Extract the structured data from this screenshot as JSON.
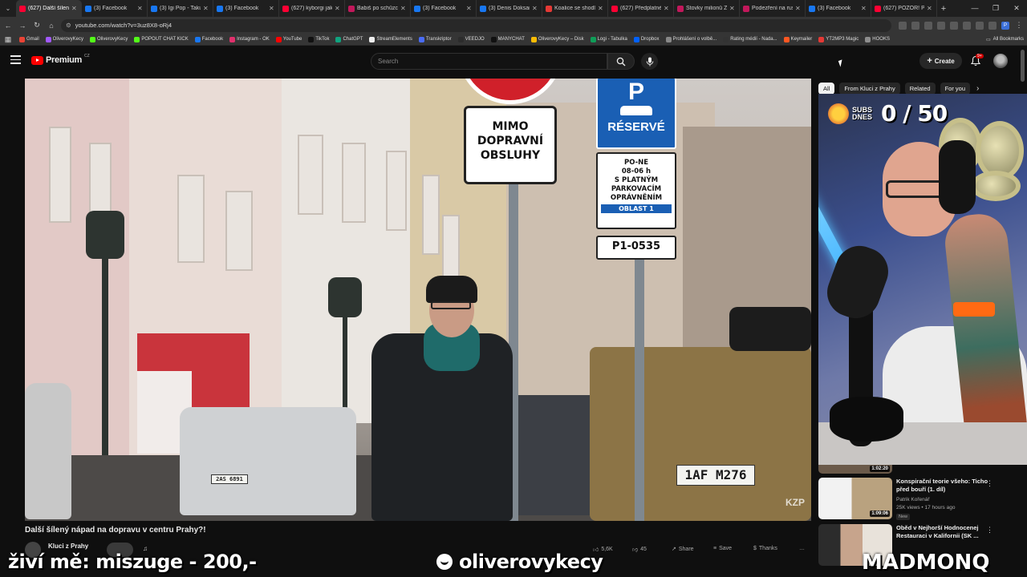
{
  "browser": {
    "tabs": [
      {
        "title": "(627) Další šílený",
        "color": "#ff0033",
        "active": true
      },
      {
        "title": "(3) Facebook",
        "color": "#1877f2"
      },
      {
        "title": "(3) Igi Pop - Taku",
        "color": "#1877f2"
      },
      {
        "title": "(3) Facebook",
        "color": "#1877f2"
      },
      {
        "title": "(627) kyborgi jak",
        "color": "#ff0033"
      },
      {
        "title": "Babiš po schůzce",
        "color": "#c2185b"
      },
      {
        "title": "(3) Facebook",
        "color": "#1877f2"
      },
      {
        "title": "(3) Denis Doksan",
        "color": "#1877f2"
      },
      {
        "title": "Koalice se shodla",
        "color": "#e53935"
      },
      {
        "title": "(627) Předplatné",
        "color": "#ff0033"
      },
      {
        "title": "Stovky milionů Z",
        "color": "#c2185b"
      },
      {
        "title": "Podezření na rus",
        "color": "#c2185b"
      },
      {
        "title": "(3) Facebook",
        "color": "#1877f2"
      },
      {
        "title": "(627) POZOR! Po",
        "color": "#ff0033"
      }
    ],
    "url": "youtube.com/watch?v=3uz8X8-oRj4",
    "bookmarks": [
      {
        "label": "Gmail",
        "color": "#ea4335"
      },
      {
        "label": "OliverovyKecy",
        "color": "#a259ff"
      },
      {
        "label": "OliverovyKecy",
        "color": "#53fc18"
      },
      {
        "label": "POPOUT CHAT KICK",
        "color": "#53fc18"
      },
      {
        "label": "Facebook",
        "color": "#1877f2"
      },
      {
        "label": "Instagram - OK",
        "color": "#e1306c"
      },
      {
        "label": "YouTube",
        "color": "#ff0000"
      },
      {
        "label": "TikTok",
        "color": "#111111"
      },
      {
        "label": "ChatGPT",
        "color": "#10a37f"
      },
      {
        "label": "StreamElements",
        "color": "#eeeeee"
      },
      {
        "label": "Transkriptor",
        "color": "#4a6cf7"
      },
      {
        "label": "VEEDJO",
        "color": "#2c2c2c"
      },
      {
        "label": "MANYCHAT",
        "color": "#111111"
      },
      {
        "label": "OliverovyKecy – Disk",
        "color": "#fbbc04"
      },
      {
        "label": "Logi - Tabulka",
        "color": "#0f9d58"
      },
      {
        "label": "Dropbox",
        "color": "#0061ff"
      },
      {
        "label": "Prohlášení o volbě...",
        "color": "#888888"
      },
      {
        "label": "Rating médií - Nada...",
        "color": "#333333"
      },
      {
        "label": "Keymailer",
        "color": "#ff5722"
      },
      {
        "label": "YT2MP3 Magic",
        "color": "#e53935"
      },
      {
        "label": "HOOKS",
        "color": "#8e8e8e"
      }
    ],
    "all_bookmarks": "All Bookmarks"
  },
  "youtube": {
    "logo_word": "Premium",
    "country": "CZ",
    "search_placeholder": "Search",
    "create_label": "Create",
    "notif_badge": "9+",
    "video_title": "Další šílený nápad na dopravu v centru Prahy?!",
    "channel_name": "Kluci z Prahy",
    "likes": "5,6K",
    "dislikes": "45",
    "share_label": "Share",
    "save_label": "Save",
    "thanks_label": "Thanks",
    "watermark": "KZP"
  },
  "street_signs": {
    "mimo": "MIMO\nDOPRAVNÍ\nOBSLUHY",
    "reserve": "RÉSERVÉ",
    "zone_text": "PO-NE\n08-06 h\nS PLATNÝM\nPARKOVACÍM\nOPRÁVNĚNÍM",
    "zone_area": "OBLAST 1",
    "zone_code": "P1-0535",
    "plate_right": "1AF M276"
  },
  "sidebar": {
    "chips": [
      {
        "label": "All",
        "active": true
      },
      {
        "label": "From Kluci z Prahy"
      },
      {
        "label": "Related"
      },
      {
        "label": "For you"
      }
    ],
    "partial_duration": "1:02:20",
    "recs": [
      {
        "title": "Konspirační teorie všeho: Ticho před bouří (1. díl)",
        "channel": "Patrik Kořenář",
        "meta": "25K views • 17 hours ago",
        "badge": "New",
        "duration": "1:09:06"
      },
      {
        "title": "Oběd v Nejhorší Hodnocenej Restauraci v Kalifornii (SK ...",
        "channel": "",
        "meta": "",
        "badge": "",
        "duration": ""
      }
    ]
  },
  "webcam": {
    "subs_label": "SUBS DNES",
    "subs_count": "0 / 50"
  },
  "stream_overlay": {
    "left_text": "živí mě: miszuge - 200,-",
    "handle": "oliverovykecy",
    "right_text": "MADMONQ"
  }
}
